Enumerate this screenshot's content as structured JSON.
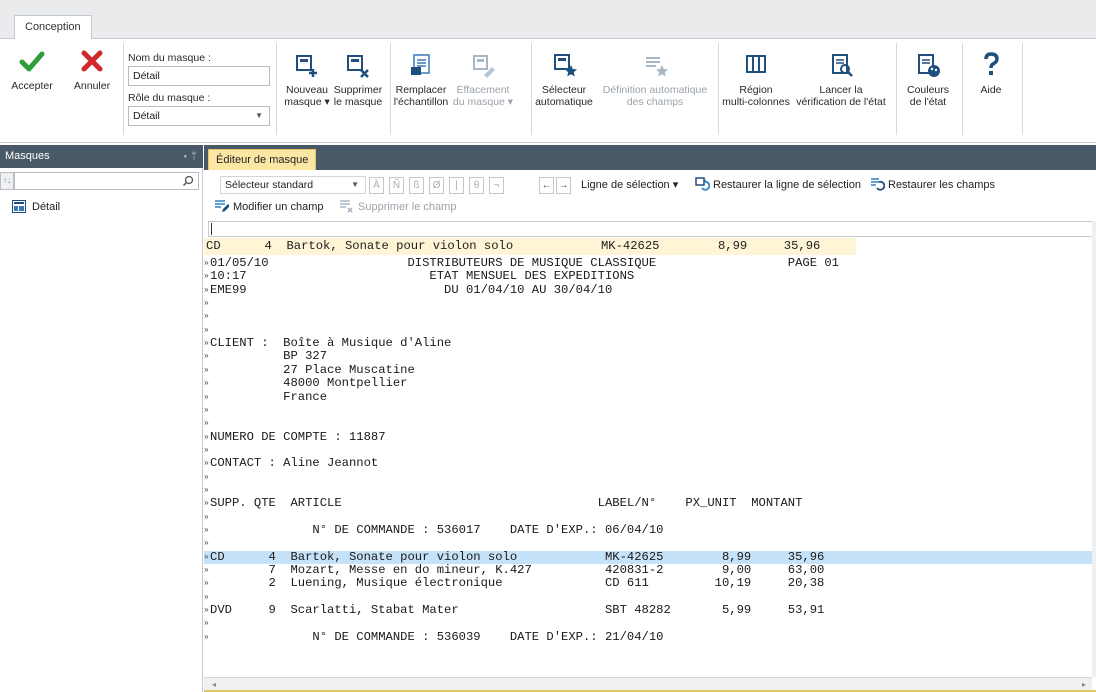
{
  "ribbon": {
    "tab": "Conception",
    "accept": "Accepter",
    "cancel": "Annuler",
    "mask_name_label": "Nom du masque :",
    "mask_name_value": "Détail",
    "mask_role_label": "Rôle du masque :",
    "mask_role_value": "Détail",
    "new_mask": [
      "Nouveau",
      "masque ▾"
    ],
    "delete_mask": [
      "Supprimer",
      "le masque"
    ],
    "replace_sample": [
      "Remplacer",
      "l'échantillon"
    ],
    "clear_mask": [
      "Effacement",
      "du masque ▾"
    ],
    "auto_selector": [
      "Sélecteur",
      "automatique"
    ],
    "auto_fields": [
      "Définition automatique",
      "des champs"
    ],
    "region": [
      "Région",
      "multi-colonnes"
    ],
    "check_state": [
      "Lancer la",
      "vérification de l'état"
    ],
    "state_colors": [
      "Couleurs",
      "de l'état"
    ],
    "help": "Aide"
  },
  "left_panel": {
    "title": "Masques",
    "pin": "▾ ᛘ",
    "sort": "↑↓",
    "item": "Détail"
  },
  "editor": {
    "tab": "Éditeur de masque",
    "selector": "Sélecteur standard",
    "glyphs": [
      "Ā",
      "Ñ",
      "ß",
      "Ø",
      "|",
      "θ",
      "¬"
    ],
    "nav": [
      "←",
      "→"
    ],
    "selection_line": "Ligne de sélection ▾",
    "restore_selection": "Restaurer la ligne de sélection",
    "restore_fields": "Restaurer les champs",
    "modify_field": "Modifier un champ",
    "delete_field": "Supprimer le champ",
    "pattern_line": "CD      4  Bartok, Sonate pour violon solo            MK-42625        8,99     35,96",
    "lines": [
      "01/05/10                   DISTRIBUTEURS DE MUSIQUE CLASSIQUE                  PAGE 01",
      "10:17                         ETAT MENSUEL DES EXPEDITIONS",
      "EME99                           DU 01/04/10 AU 30/04/10",
      "",
      "",
      "",
      "CLIENT :  Boîte à Musique d'Aline",
      "          BP 327",
      "          27 Place Muscatine",
      "          48000 Montpellier",
      "          France",
      "",
      "",
      "NUMERO DE COMPTE : 11887",
      "",
      "CONTACT : Aline Jeannot",
      "",
      "",
      "SUPP. QTE  ARTICLE                                   LABEL/N°    PX_UNIT  MONTANT",
      "",
      "              N° DE COMMANDE : 536017    DATE D'EXP.: 06/04/10",
      "",
      "CD      4  Bartok, Sonate pour violon solo            MK-42625        8,99     35,96",
      "        7  Mozart, Messe en do mineur, K.427          420831-2        9,00     63,00",
      "        2  Luening, Musique électronique              CD 611         10,19     20,38",
      "",
      "DVD     9  Scarlatti, Stabat Mater                    SBT 48282       5,99     53,91",
      "",
      "              N° DE COMMANDE : 536039    DATE D'EXP.: 21/04/10"
    ],
    "line_marker": "»",
    "hscroll": [
      "◂",
      "▸"
    ]
  }
}
